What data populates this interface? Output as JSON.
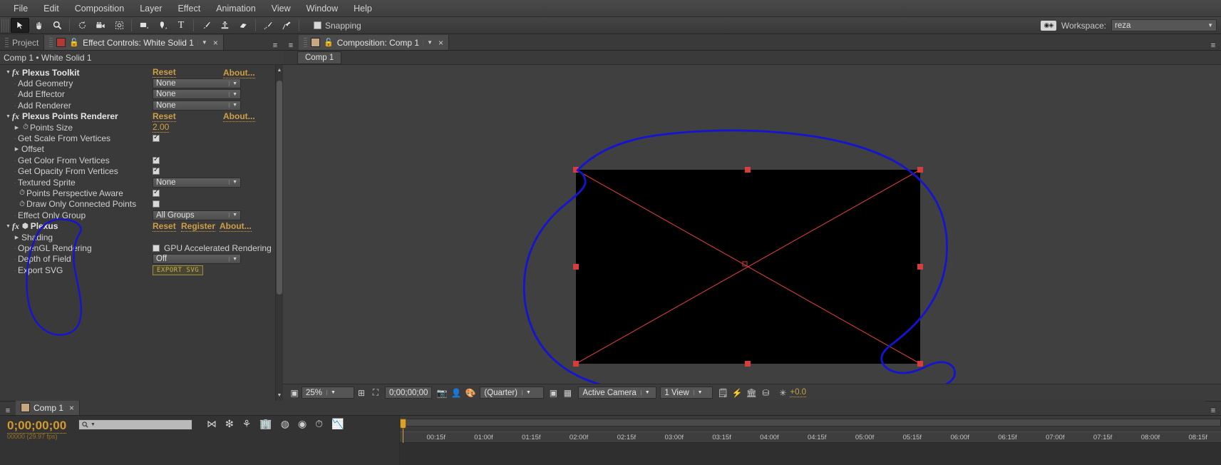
{
  "menubar": {
    "items": [
      "File",
      "Edit",
      "Composition",
      "Layer",
      "Effect",
      "Animation",
      "View",
      "Window",
      "Help"
    ]
  },
  "toolbar": {
    "tools": [
      {
        "name": "selection-tool",
        "glyph": "➤",
        "selected": true
      },
      {
        "name": "hand-tool",
        "glyph": "✋",
        "selected": false
      },
      {
        "name": "zoom-tool",
        "glyph": "🔍",
        "selected": false
      },
      {
        "name": "rotation-tool",
        "glyph": "↻",
        "selected": false
      },
      {
        "name": "camera-tool",
        "glyph": "🎥",
        "selected": false
      },
      {
        "name": "pan-behind-tool",
        "glyph": "⌗",
        "selected": false
      },
      {
        "name": "shape-tool",
        "glyph": "▢",
        "selected": false
      },
      {
        "name": "pen-tool",
        "glyph": "✒",
        "selected": false
      },
      {
        "name": "type-tool",
        "glyph": "T",
        "selected": false
      },
      {
        "name": "brush-tool",
        "glyph": "🖌",
        "selected": false
      },
      {
        "name": "clone-stamp-tool",
        "glyph": "⚲",
        "selected": false
      },
      {
        "name": "eraser-tool",
        "glyph": "▱",
        "selected": false
      },
      {
        "name": "roto-brush-tool",
        "glyph": "🖍",
        "selected": false
      },
      {
        "name": "puppet-pin-tool",
        "glyph": "📌",
        "selected": false
      }
    ],
    "snapping_label": "Snapping",
    "snapping_checked": false,
    "workspace_label": "Workspace:",
    "workspace_value": "reza"
  },
  "effect_controls": {
    "tab_project_label": "Project",
    "tab_label": "Effect Controls: White Solid 1",
    "path_label": "Comp 1 • White Solid 1",
    "groups": [
      {
        "name": "Plexus Toolkit",
        "expanded": true,
        "actions": [
          "Reset",
          "About..."
        ],
        "rows": [
          {
            "label": "Add Geometry",
            "type": "dropdown",
            "value": "None"
          },
          {
            "label": "Add Effector",
            "type": "dropdown",
            "value": "None"
          },
          {
            "label": "Add Renderer",
            "type": "dropdown",
            "value": "None"
          }
        ]
      },
      {
        "name": "Plexus Points Renderer",
        "expanded": true,
        "actions": [
          "Reset",
          "About..."
        ],
        "rows": [
          {
            "label": "Points Size",
            "type": "number",
            "value": "2.00",
            "twirl": true,
            "stopwatch": true
          },
          {
            "label": "Get Scale From Vertices",
            "type": "checkbox",
            "checked": true
          },
          {
            "label": "Offset",
            "type": "group",
            "twirl": true
          },
          {
            "label": "Get Color From Vertices",
            "type": "checkbox",
            "checked": true
          },
          {
            "label": "Get Opacity From Vertices",
            "type": "checkbox",
            "checked": true
          },
          {
            "label": "Textured Sprite",
            "type": "dropdown",
            "value": "None"
          },
          {
            "label": "Points Perspective Aware",
            "type": "checkbox",
            "checked": true,
            "stopwatch": true
          },
          {
            "label": "Draw Only Connected Points",
            "type": "checkbox",
            "checked": false,
            "stopwatch": true
          },
          {
            "label": "Effect Only Group",
            "type": "dropdown",
            "value": "All Groups"
          }
        ]
      },
      {
        "name": "Plexus",
        "expanded": true,
        "actions": [
          "Reset",
          "Register",
          "About..."
        ],
        "rows": [
          {
            "label": "Shading",
            "type": "group",
            "twirl": true
          },
          {
            "label": "OpenGL Rendering",
            "type": "checkbox-text",
            "checked": false,
            "value": "GPU Accelerated Rendering"
          },
          {
            "label": "Depth of Field",
            "type": "dropdown",
            "value": "Off"
          },
          {
            "label": "Export SVG",
            "type": "button",
            "value": "EXPORT SVG"
          }
        ]
      }
    ]
  },
  "composition": {
    "tab_label": "Composition: Comp 1",
    "subtab_label": "Comp 1",
    "viewer_bar": {
      "zoom": "25%",
      "timecode": "0;00;00;00",
      "resolution": "(Quarter)",
      "camera": "Active Camera",
      "views": "1 View",
      "exposure": "+0.0"
    }
  },
  "timeline": {
    "tab_label": "Comp 1",
    "current_time": "0;00;00;00",
    "current_time_sub": "00000 (29.97 fps)",
    "search_placeholder": "",
    "ruler_ticks": [
      "00:15f",
      "01:00f",
      "01:15f",
      "02:00f",
      "02:15f",
      "03:00f",
      "03:15f",
      "04:00f",
      "04:15f",
      "05:00f",
      "05:15f",
      "06:00f",
      "06:15f",
      "07:00f",
      "07:15f",
      "08:00f",
      "08:15f"
    ]
  },
  "colors": {
    "accent_orange": "#cf9f46",
    "annotation_blue": "#1414d2",
    "selection_red": "#e03c3c",
    "svg_button": "#c9b24a"
  }
}
